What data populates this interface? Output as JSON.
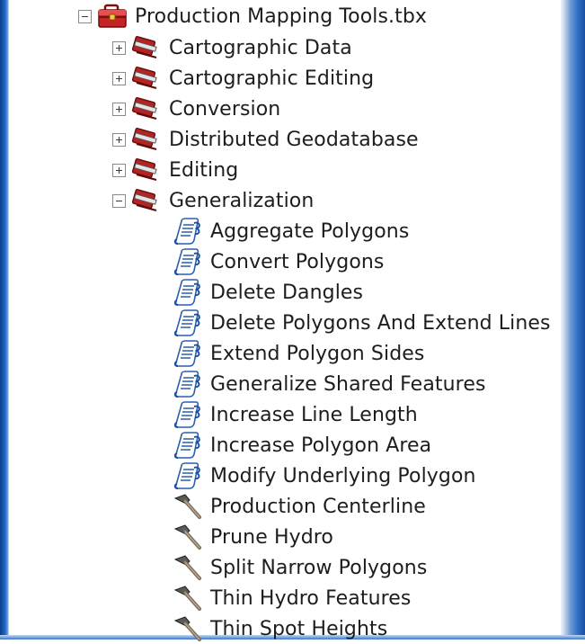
{
  "root": {
    "label": "Production Mapping Tools.tbx",
    "expander": "collapse",
    "icon": "toolbox-icon"
  },
  "toolsets": [
    {
      "label": "Cartographic Data",
      "expander": "expand",
      "icon": "toolset-icon"
    },
    {
      "label": "Cartographic Editing",
      "expander": "expand",
      "icon": "toolset-icon"
    },
    {
      "label": "Conversion",
      "expander": "expand",
      "icon": "toolset-icon"
    },
    {
      "label": "Distributed Geodatabase",
      "expander": "expand",
      "icon": "toolset-icon"
    },
    {
      "label": "Editing",
      "expander": "expand",
      "icon": "toolset-icon"
    },
    {
      "label": "Generalization",
      "expander": "collapse",
      "icon": "toolset-icon"
    }
  ],
  "tools": [
    {
      "label": "Aggregate Polygons",
      "icon": "script-tool-icon"
    },
    {
      "label": "Convert Polygons",
      "icon": "script-tool-icon"
    },
    {
      "label": "Delete Dangles",
      "icon": "script-tool-icon"
    },
    {
      "label": "Delete Polygons And Extend Lines",
      "icon": "script-tool-icon"
    },
    {
      "label": "Extend Polygon Sides",
      "icon": "script-tool-icon"
    },
    {
      "label": "Generalize Shared Features",
      "icon": "script-tool-icon"
    },
    {
      "label": "Increase Line Length",
      "icon": "script-tool-icon"
    },
    {
      "label": "Increase Polygon Area",
      "icon": "script-tool-icon"
    },
    {
      "label": "Modify Underlying Polygon",
      "icon": "script-tool-icon"
    },
    {
      "label": "Production Centerline",
      "icon": "hammer-tool-icon"
    },
    {
      "label": "Prune Hydro",
      "icon": "hammer-tool-icon"
    },
    {
      "label": "Split Narrow Polygons",
      "icon": "hammer-tool-icon"
    },
    {
      "label": "Thin Hydro Features",
      "icon": "hammer-tool-icon"
    },
    {
      "label": "Thin Spot Heights",
      "icon": "hammer-tool-icon"
    }
  ]
}
